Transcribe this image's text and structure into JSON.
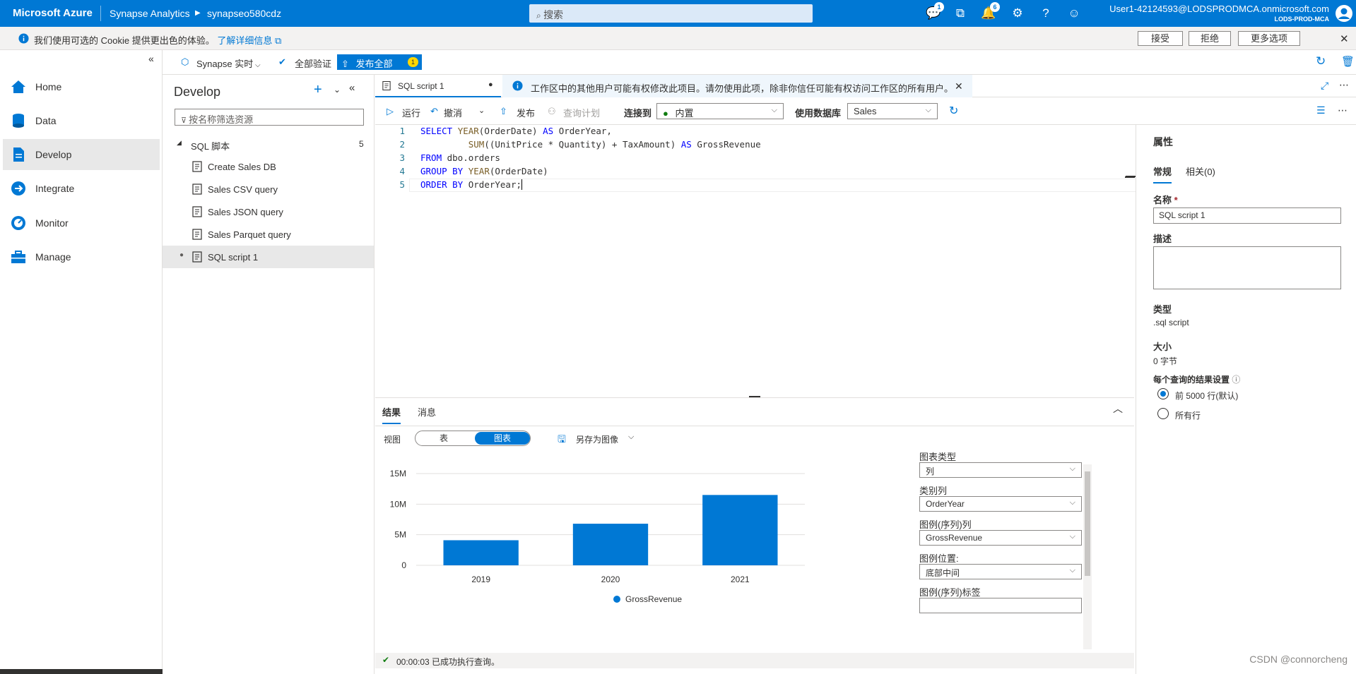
{
  "topbar": {
    "brand": "Microsoft Azure",
    "app": "Synapse Analytics",
    "workspace": "synapseo580cdz",
    "search_placeholder": "搜索",
    "badge_feedback": "1",
    "badge_notifications": "6",
    "user": "User1-42124593@LODSPRODMCA.onmicrosoft.com",
    "tenant": "LODS-PROD-MCA"
  },
  "cookie": {
    "message": "我们使用可选的 Cookie 提供更出色的体验。",
    "link": "了解详细信息",
    "accept": "接受",
    "reject": "拒绝",
    "more": "更多选项"
  },
  "nav": {
    "items": [
      {
        "label": "Home",
        "icon": "home-icon"
      },
      {
        "label": "Data",
        "icon": "database-icon"
      },
      {
        "label": "Develop",
        "icon": "document-icon"
      },
      {
        "label": "Integrate",
        "icon": "pipeline-icon"
      },
      {
        "label": "Monitor",
        "icon": "gauge-icon"
      },
      {
        "label": "Manage",
        "icon": "toolbox-icon"
      }
    ],
    "active": "Develop"
  },
  "hubbar": {
    "synapse_live": "Synapse 实时",
    "validate_all": "全部验证",
    "publish_all": "发布全部",
    "publish_count": "1"
  },
  "develop": {
    "title": "Develop",
    "filter_placeholder": "按名称筛选资源",
    "group_label": "SQL 脚本",
    "group_count": "5",
    "items": [
      "Create Sales DB",
      "Sales CSV query",
      "Sales JSON query",
      "Sales Parquet query",
      "SQL script 1"
    ]
  },
  "editor": {
    "tab_label": "SQL script 1",
    "info_text": "工作区中的其他用户可能有权修改此项目。请勿使用此项，除非你信任可能有权访问工作区的所有用户。",
    "toolbar": {
      "run": "运行",
      "undo": "撤消",
      "publish": "发布",
      "query_plan": "查询计划",
      "connect_to_label": "连接到",
      "connect_to_value": "内置",
      "use_db_label": "使用数据库",
      "use_db_value": "Sales"
    },
    "lines": [
      "1",
      "2",
      "3",
      "4",
      "5"
    ]
  },
  "results": {
    "tab_results": "结果",
    "tab_messages": "消息",
    "view_label": "视图",
    "view_table": "表",
    "view_chart": "图表",
    "save_as_image": "另存为图像",
    "status": "00:00:03 已成功执行查询。"
  },
  "chart_settings": {
    "chart_type_label": "图表类型",
    "chart_type_value": "列",
    "category_label": "类别列",
    "category_value": "OrderYear",
    "legend_series_label": "图例(序列)列",
    "legend_series_value": "GrossRevenue",
    "legend_position_label": "图例位置:",
    "legend_position_value": "底部中间",
    "legend_label_label": "图例(序列)标签"
  },
  "chart_data": {
    "type": "bar",
    "categories": [
      "2019",
      "2020",
      "2021"
    ],
    "series": [
      {
        "name": "GrossRevenue",
        "values": [
          4.1,
          6.8,
          11.5
        ]
      }
    ],
    "value_unit": "M",
    "ylim": [
      0,
      15
    ],
    "yticks": [
      "0",
      "5M",
      "10M",
      "15M"
    ],
    "ytick_values": [
      0,
      5,
      10,
      15
    ],
    "legend_position": "bottom-center",
    "grid": true,
    "color": "#0078d4"
  },
  "properties": {
    "title": "属性",
    "tab_general": "常规",
    "tab_related": "相关(0)",
    "name_label": "名称",
    "name_value": "SQL script 1",
    "desc_label": "描述",
    "type_label": "类型",
    "type_value": ".sql script",
    "size_label": "大小",
    "size_value": "0 字节",
    "result_setting_label": "每个查询的结果设置",
    "opt_first": "前 5000 行(默认)",
    "opt_all": "所有行"
  },
  "watermark": "CSDN @connorcheng",
  "colors": {
    "accent": "#0078d4",
    "success": "#107c10"
  }
}
